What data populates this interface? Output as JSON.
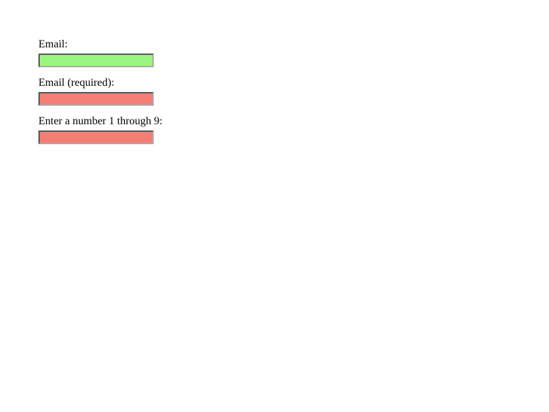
{
  "fields": {
    "email": {
      "label": "Email:",
      "value": "",
      "valid": true
    },
    "email_required": {
      "label": "Email (required):",
      "value": "",
      "valid": false
    },
    "number": {
      "label": "Enter a number 1 through 9:",
      "value": "",
      "valid": false
    }
  }
}
